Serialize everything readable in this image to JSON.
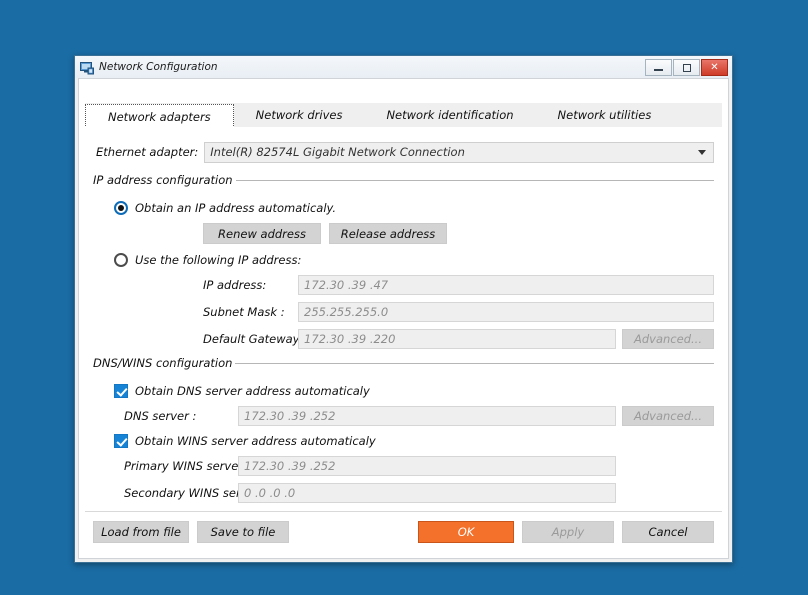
{
  "desktop": {
    "background_color": "#1a6ca4"
  },
  "window": {
    "title": "Network Configuration",
    "icon": "network-monitor-icon",
    "controls": {
      "minimize": "minimize-icon",
      "maximize": "maximize-icon",
      "close": "✕"
    }
  },
  "tabs": [
    {
      "label": "Network adapters",
      "active": true
    },
    {
      "label": "Network drives",
      "active": false
    },
    {
      "label": "Network identification",
      "active": false
    },
    {
      "label": "Network utilities",
      "active": false
    }
  ],
  "adapter": {
    "label": "Ethernet adapter:",
    "value": "Intel(R) 82574L Gigabit Network Connection",
    "arrow_icon": "chevron-down-icon"
  },
  "ip_group": {
    "title": "IP address configuration",
    "auto_radio": {
      "label": "Obtain an IP address automaticaly.",
      "selected": true
    },
    "renew_button": "Renew address",
    "release_button": "Release address",
    "static_radio": {
      "label": "Use the following IP address:",
      "selected": false
    },
    "fields": [
      {
        "label": "IP address:",
        "value": "172.30 .39 .47"
      },
      {
        "label": "Subnet Mask :",
        "value": "255.255.255.0"
      },
      {
        "label": "Default Gateway :",
        "value": "172.30 .39 .220"
      }
    ],
    "advanced_button": "Advanced..."
  },
  "dns_group": {
    "title": "DNS/WINS configuration",
    "dns_auto": {
      "label": "Obtain DNS server address automaticaly",
      "checked": true
    },
    "dns_field": {
      "label": "DNS server :",
      "value": "172.30 .39 .252"
    },
    "dns_advanced_button": "Advanced...",
    "wins_auto": {
      "label": "Obtain WINS server address automaticaly",
      "checked": true
    },
    "wins_fields": [
      {
        "label": "Primary WINS server :",
        "value": "172.30 .39 .252"
      },
      {
        "label": "Secondary WINS server:",
        "value": "0 .0 .0 .0"
      }
    ]
  },
  "footer": {
    "load_button": "Load from file",
    "save_button": "Save to file",
    "ok_button": "OK",
    "apply_button": "Apply",
    "cancel_button": "Cancel"
  },
  "colors": {
    "accent_orange": "#f4712b",
    "accent_blue": "#1783d4",
    "radio_blue": "#0d6cb8",
    "desktop_blue": "#1a6ca4"
  }
}
